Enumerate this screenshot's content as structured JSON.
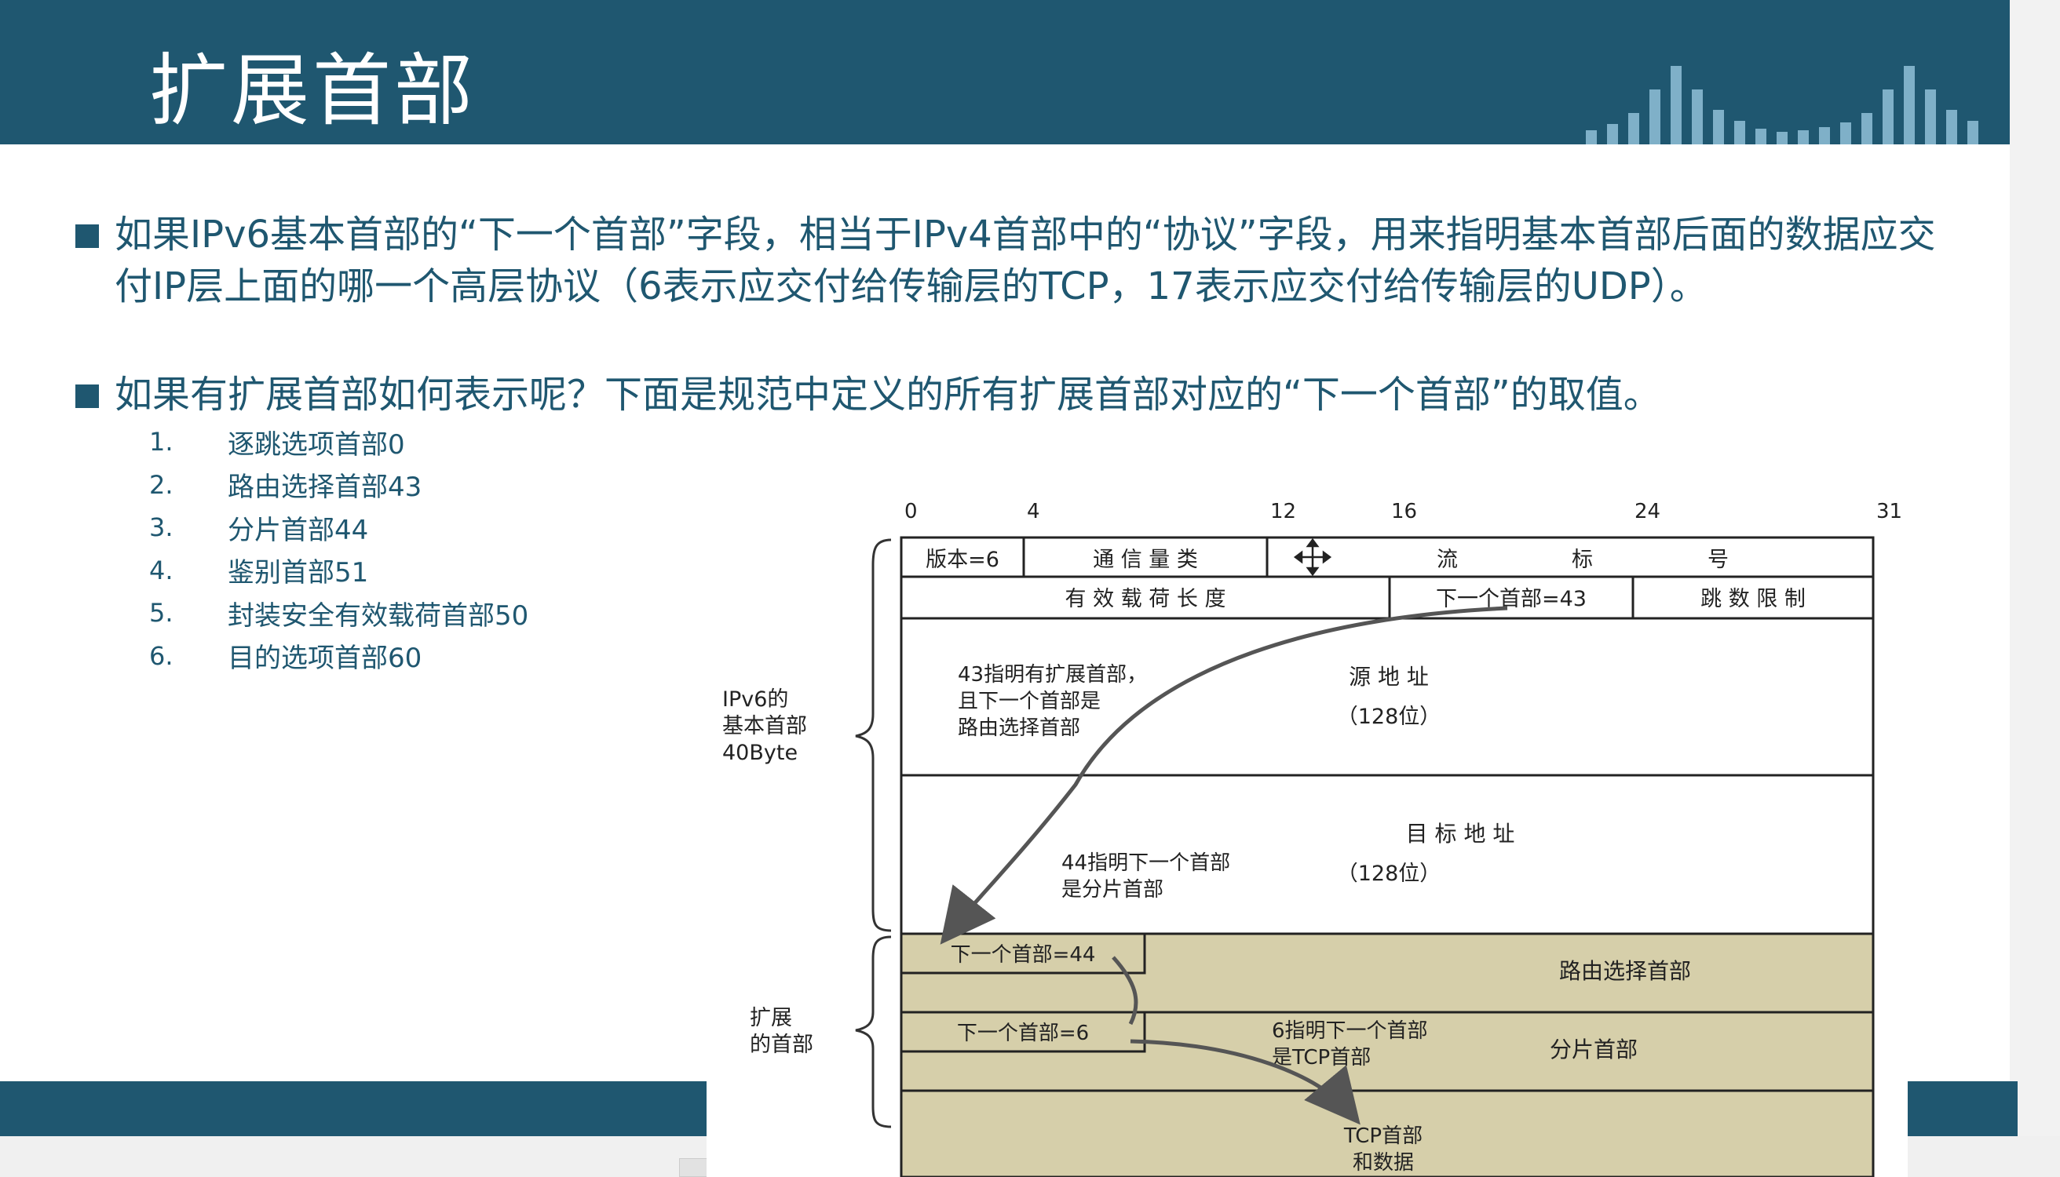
{
  "slide": {
    "title": "扩展首部",
    "bullets": [
      "如果IPv6基本首部的“下一个首部”字段，相当于IPv4首部中的“协议”字段，用来指明基本首部后面的数据应交付IP层上面的哪一个高层协议（6表示应交付给传输层的TCP，17表示应交付给传输层的UDP）。",
      "如果有扩展首部如何表示呢？下面是规范中定义的所有扩展首部对应的“下一个首部”的取值。"
    ],
    "list": [
      {
        "num": "1.",
        "text": "逐跳选项首部0"
      },
      {
        "num": "2.",
        "text": "路由选择首部43"
      },
      {
        "num": "3.",
        "text": "分片首部44"
      },
      {
        "num": "4.",
        "text": "鉴别首部51"
      },
      {
        "num": "5.",
        "text": "封装安全有效载荷首部50"
      },
      {
        "num": "6.",
        "text": "目的选项首部60"
      }
    ]
  },
  "diagram": {
    "bit_ticks": [
      "0",
      "4",
      "12",
      "16",
      "24",
      "31"
    ],
    "row1": {
      "version": "版本=6",
      "traffic_class": "通 信 量 类",
      "flow_label": [
        "流",
        "标",
        "号"
      ]
    },
    "row2": {
      "payload_length": "有 效 载 荷 长 度",
      "next_header": "下一个首部=43",
      "hop_limit": "跳 数 限 制"
    },
    "source": {
      "label": "源 地 址",
      "bits": "（128位）"
    },
    "dest": {
      "label": "目 标 地 址",
      "bits": "（128位）"
    },
    "annotation_43": [
      "43指明有扩展首部，",
      "且下一个首部是",
      "路由选择首部"
    ],
    "annotation_44": [
      "44指明下一个首部",
      "是分片首部"
    ],
    "annotation_6": [
      "6指明下一个首部",
      "是TCP首部"
    ],
    "routing": {
      "next": "下一个首部=44",
      "name": "路由选择首部"
    },
    "fragment": {
      "next": "下一个首部=6",
      "name": "分片首部"
    },
    "tcp": [
      "TCP首部",
      "和数据"
    ],
    "brace_basic": [
      "IPv6的",
      "基本首部",
      "40Byte"
    ],
    "brace_ext": [
      "扩展",
      "的首部"
    ],
    "colors": {
      "header": "#1f5770",
      "extension_fill": "#d6cfaa"
    }
  }
}
